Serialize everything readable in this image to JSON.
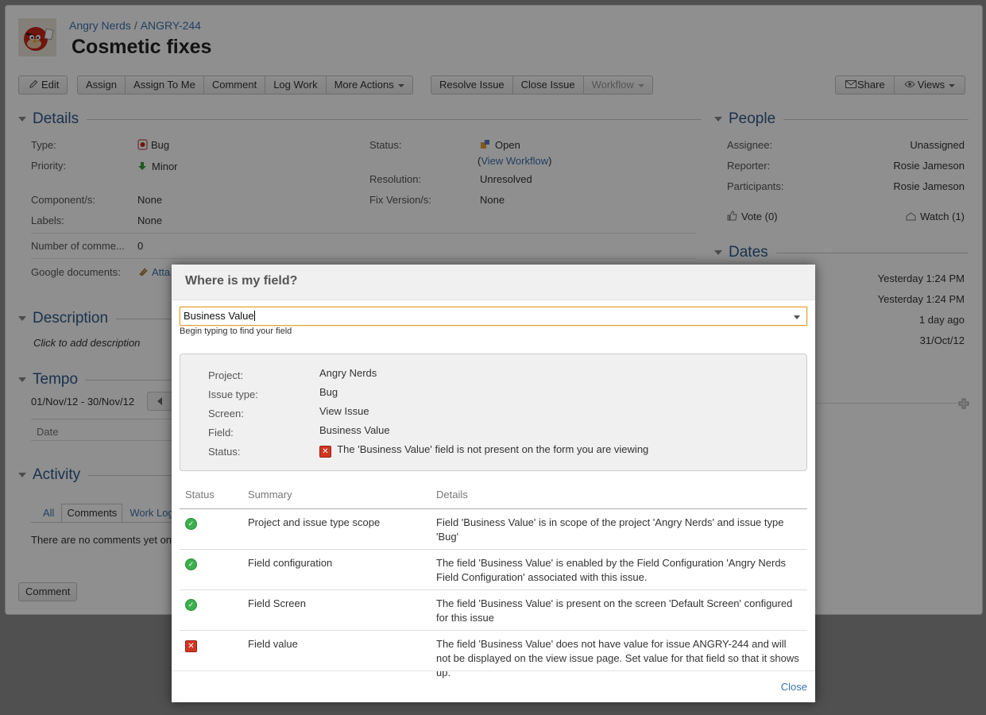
{
  "breadcrumb": {
    "project": "Angry Nerds",
    "separator": "/",
    "issue_key": "ANGRY-244"
  },
  "issue": {
    "title": "Cosmetic fixes"
  },
  "toolbar": {
    "edit": "Edit",
    "assign": "Assign",
    "assign_to_me": "Assign To Me",
    "comment": "Comment",
    "log_work": "Log Work",
    "more_actions": "More Actions",
    "resolve_issue": "Resolve Issue",
    "close_issue": "Close Issue",
    "workflow": "Workflow",
    "share": "Share",
    "views": "Views"
  },
  "details": {
    "heading": "Details",
    "type_label": "Type:",
    "type_value": "Bug",
    "priority_label": "Priority:",
    "priority_value": "Minor",
    "components_label": "Component/s:",
    "components_value": "None",
    "labels_label": "Labels:",
    "labels_value": "None",
    "comments_label": "Number of comme...",
    "comments_value": "0",
    "gdocs_label": "Google documents:",
    "gdocs_value": "Atta",
    "status_label": "Status:",
    "status_value": "Open",
    "view_workflow_open": "(",
    "view_workflow": "View Workflow",
    "view_workflow_close": ")",
    "resolution_label": "Resolution:",
    "resolution_value": "Unresolved",
    "fix_label": "Fix Version/s:",
    "fix_value": "None"
  },
  "people": {
    "heading": "People",
    "assignee_label": "Assignee:",
    "assignee_value": "Unassigned",
    "reporter_label": "Reporter:",
    "reporter_value": "Rosie Jameson",
    "participants_label": "Participants:",
    "participants_value": "Rosie Jameson",
    "vote": "Vote (0)",
    "watch": "Watch (1)"
  },
  "dates": {
    "heading": "Dates",
    "values": [
      "Yesterday 1:24 PM",
      "Yesterday 1:24 PM",
      "1 day ago",
      "31/Oct/12"
    ]
  },
  "description": {
    "heading": "Description",
    "placeholder": "Click to add description"
  },
  "tempo": {
    "heading": "Tempo",
    "range": "01/Nov/12 - 30/Nov/12",
    "date_col": "Date"
  },
  "activity": {
    "heading": "Activity",
    "tabs": [
      "All",
      "Comments",
      "Work Log"
    ],
    "empty_text": "There are no comments yet on",
    "comment_button": "Comment"
  },
  "modal": {
    "title": "Where is my field?",
    "field_value": "Business Value",
    "hint": "Begin typing to find your field",
    "info": [
      {
        "key": "Project:",
        "value": "Angry Nerds"
      },
      {
        "key": "Issue type:",
        "value": "Bug"
      },
      {
        "key": "Screen:",
        "value": "View Issue"
      },
      {
        "key": "Field:",
        "value": "Business Value"
      },
      {
        "key": "Status:",
        "value": "The 'Business Value' field is not present on the form you are viewing"
      }
    ],
    "columns": {
      "status": "Status",
      "summary": "Summary",
      "details": "Details"
    },
    "rows": [
      {
        "status": "ok",
        "summary": "Project and issue type scope",
        "details": "Field 'Business Value' is in scope of the project 'Angry Nerds' and issue type 'Bug'"
      },
      {
        "status": "ok",
        "summary": "Field configuration",
        "details": "The field 'Business Value' is enabled by the Field Configuration 'Angry Nerds Field Configuration' associated with this issue."
      },
      {
        "status": "ok",
        "summary": "Field Screen",
        "details": "The field 'Business Value' is present on the screen 'Default Screen' configured for this issue"
      },
      {
        "status": "error",
        "summary": "Field value",
        "details": "The field 'Business Value' does not have value for issue ANGRY-244 and will not be displayed on the view issue page. Set value for that field so that it shows up."
      }
    ],
    "close": "Close"
  },
  "colors": {
    "link": "#3b73af",
    "heading": "#2e5a8c",
    "ok": "#3bb04d",
    "error": "#d03624",
    "focus": "#e0a23a"
  }
}
